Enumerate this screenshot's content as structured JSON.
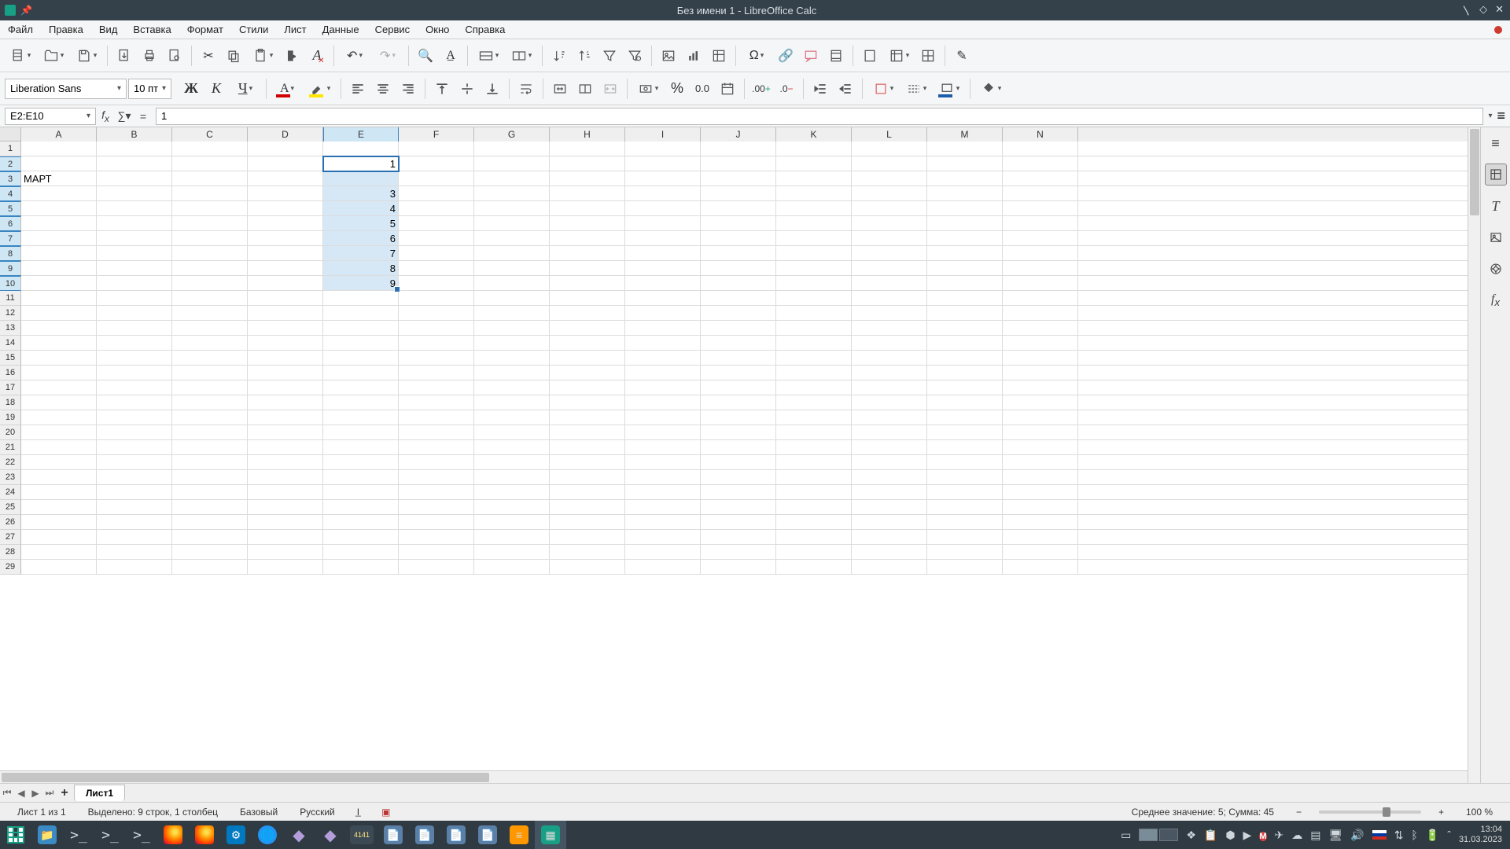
{
  "titlebar": {
    "title": "Без имени 1 - LibreOffice Calc"
  },
  "menu": [
    "Файл",
    "Правка",
    "Вид",
    "Вставка",
    "Формат",
    "Стили",
    "Лист",
    "Данные",
    "Сервис",
    "Окно",
    "Справка"
  ],
  "format_toolbar": {
    "font_name": "Liberation Sans",
    "font_size": "10 пт",
    "bold": "Ж",
    "italic": "К",
    "underline": "Ч"
  },
  "formula_bar": {
    "name_box": "E2:E10",
    "formula": "1"
  },
  "columns": [
    "A",
    "B",
    "C",
    "D",
    "E",
    "F",
    "G",
    "H",
    "I",
    "J",
    "K",
    "L",
    "M",
    "N"
  ],
  "rows_visible": 29,
  "selection": {
    "col": "E",
    "row_start": 2,
    "row_end": 10,
    "active_row": 2
  },
  "cells": {
    "A3": "МАРТ",
    "E2": "1",
    "E4": "3",
    "E5": "4",
    "E6": "5",
    "E7": "6",
    "E8": "7",
    "E9": "8",
    "E10": "9"
  },
  "sheet_tabs": {
    "active": "Лист1"
  },
  "statusbar": {
    "sheet_info": "Лист 1 из 1",
    "selection_info": "Выделено: 9 строк, 1 столбец",
    "style": "Базовый",
    "language": "Русский",
    "stats": "Среднее значение: 5; Сумма: 45",
    "zoom": "100 %"
  },
  "taskbar": {
    "speedo": "4141",
    "time": "13:04",
    "date": "31.03.2023"
  },
  "sidebar_icons": [
    "properties",
    "styles",
    "gallery",
    "navigator",
    "functions"
  ]
}
